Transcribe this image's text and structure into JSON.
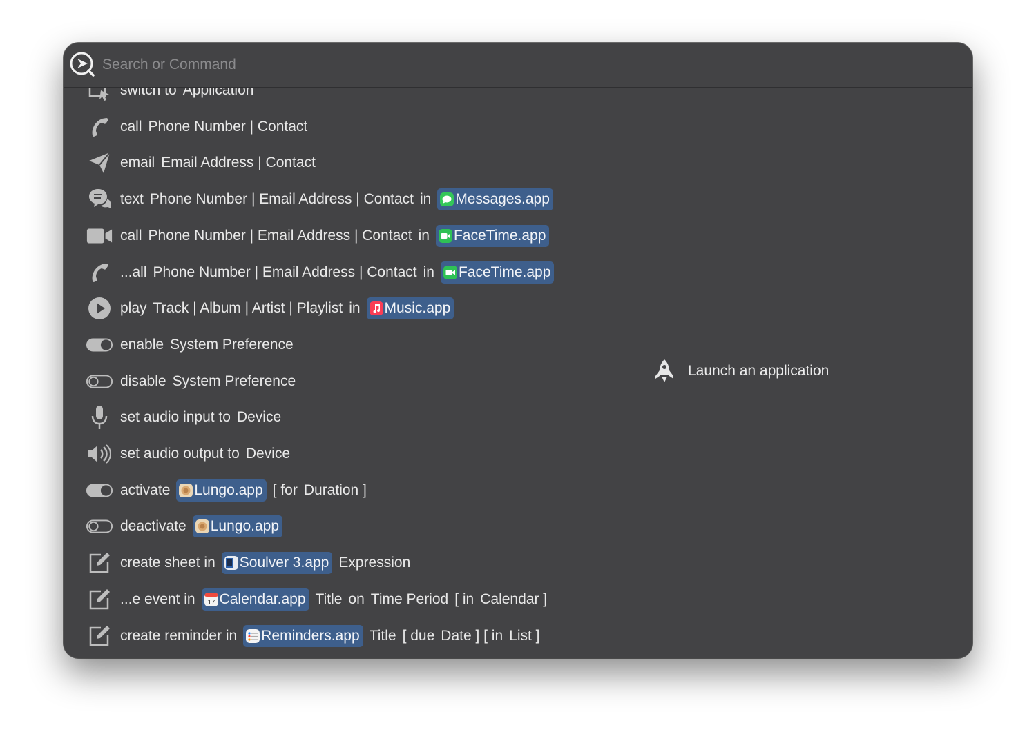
{
  "search": {
    "placeholder": "Search or Command"
  },
  "preview": {
    "label": "Launch an application",
    "icon": "rocket-icon"
  },
  "commands": [
    {
      "icon": "switch-app-icon",
      "parts": [
        {
          "t": "word",
          "v": "switch to"
        },
        {
          "t": "word",
          "v": "Application"
        }
      ]
    },
    {
      "icon": "phone-icon",
      "parts": [
        {
          "t": "word",
          "v": "call"
        },
        {
          "t": "word",
          "v": "Phone Number | Contact"
        }
      ]
    },
    {
      "icon": "paper-plane-icon",
      "parts": [
        {
          "t": "word",
          "v": "email"
        },
        {
          "t": "word",
          "v": "Email Address | Contact"
        }
      ]
    },
    {
      "icon": "chat-bubbles-icon",
      "parts": [
        {
          "t": "word",
          "v": "text"
        },
        {
          "t": "word",
          "v": "Phone Number | Email Address | Contact"
        },
        {
          "t": "word",
          "v": "in"
        },
        {
          "t": "chip",
          "v": "Messages.app",
          "app": "messages"
        }
      ]
    },
    {
      "icon": "video-camera-icon",
      "parts": [
        {
          "t": "word",
          "v": "call"
        },
        {
          "t": "word",
          "v": "Phone Number | Email Address | Contact"
        },
        {
          "t": "word",
          "v": "in"
        },
        {
          "t": "chip",
          "v": "FaceTime.app",
          "app": "facetime"
        }
      ]
    },
    {
      "icon": "phone-icon",
      "parts": [
        {
          "t": "word",
          "v": "...all"
        },
        {
          "t": "word",
          "v": "Phone Number | Email Address | Contact"
        },
        {
          "t": "word",
          "v": "in"
        },
        {
          "t": "chip",
          "v": "FaceTime.app",
          "app": "facetime"
        }
      ]
    },
    {
      "icon": "play-icon",
      "parts": [
        {
          "t": "word",
          "v": "play"
        },
        {
          "t": "word",
          "v": "Track | Album | Artist | Playlist"
        },
        {
          "t": "word",
          "v": "in"
        },
        {
          "t": "chip",
          "v": "Music.app",
          "app": "music"
        }
      ]
    },
    {
      "icon": "toggle-on-icon",
      "parts": [
        {
          "t": "word",
          "v": "enable"
        },
        {
          "t": "word",
          "v": "System Preference"
        }
      ]
    },
    {
      "icon": "toggle-off-icon",
      "parts": [
        {
          "t": "word",
          "v": "disable"
        },
        {
          "t": "word",
          "v": "System Preference"
        }
      ]
    },
    {
      "icon": "microphone-icon",
      "parts": [
        {
          "t": "word",
          "v": "set audio input to"
        },
        {
          "t": "word",
          "v": "Device"
        }
      ]
    },
    {
      "icon": "speaker-icon",
      "parts": [
        {
          "t": "word",
          "v": "set audio output to"
        },
        {
          "t": "word",
          "v": "Device"
        }
      ]
    },
    {
      "icon": "toggle-on-icon",
      "parts": [
        {
          "t": "word",
          "v": "activate"
        },
        {
          "t": "chip",
          "v": "Lungo.app",
          "app": "lungo"
        },
        {
          "t": "word",
          "v": "[ for"
        },
        {
          "t": "word",
          "v": "Duration ]"
        }
      ]
    },
    {
      "icon": "toggle-off-icon",
      "parts": [
        {
          "t": "word",
          "v": "deactivate"
        },
        {
          "t": "chip",
          "v": "Lungo.app",
          "app": "lungo"
        }
      ]
    },
    {
      "icon": "compose-icon",
      "parts": [
        {
          "t": "word",
          "v": "create sheet in"
        },
        {
          "t": "chip",
          "v": "Soulver 3.app",
          "app": "soulver"
        },
        {
          "t": "word",
          "v": "Expression"
        }
      ]
    },
    {
      "icon": "compose-icon",
      "parts": [
        {
          "t": "word",
          "v": "...e event in"
        },
        {
          "t": "chip",
          "v": "Calendar.app",
          "app": "calendar"
        },
        {
          "t": "word",
          "v": "Title"
        },
        {
          "t": "word",
          "v": "on"
        },
        {
          "t": "word",
          "v": "Time Period"
        },
        {
          "t": "word",
          "v": "[ in"
        },
        {
          "t": "word",
          "v": "Calendar ]"
        }
      ]
    },
    {
      "icon": "compose-icon",
      "parts": [
        {
          "t": "word",
          "v": "create reminder in"
        },
        {
          "t": "chip",
          "v": "Reminders.app",
          "app": "reminders"
        },
        {
          "t": "word",
          "v": "Title"
        },
        {
          "t": "word",
          "v": "[ due"
        },
        {
          "t": "word",
          "v": "Date ] [ in"
        },
        {
          "t": "word",
          "v": "List ]"
        }
      ]
    }
  ],
  "colors": {
    "window_bg": "#434345",
    "chip_bg": "#3e5f8c",
    "text": "#e8e8e8",
    "placeholder": "#8a8a8c",
    "messages": "#34c759",
    "facetime": "#2fc155",
    "music": "#fa3d55",
    "lungo": "#d9a870",
    "soulver": "#2b5fa8",
    "calendar": "#f3f3f3",
    "reminders": "#f5f5f5"
  }
}
